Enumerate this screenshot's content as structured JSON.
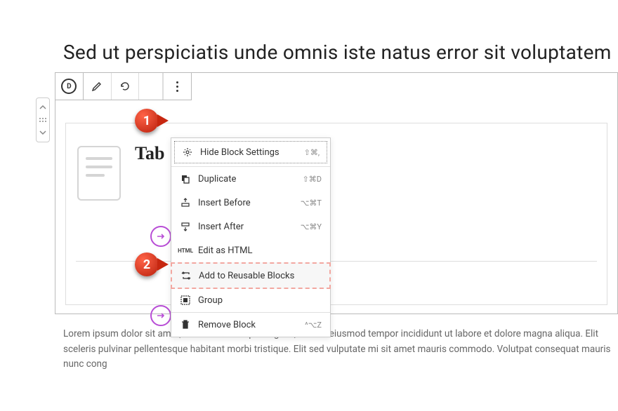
{
  "page": {
    "title": "Sed ut perspiciatis unde omnis iste natus error sit voluptatem"
  },
  "toolbar": {
    "divi_logo": "D"
  },
  "content": {
    "tab_label": "Tab",
    "body_text": "Lorem ipsum dolor sit amet, consectetur adipiscing elit, sed do eiusmod tempor incididunt ut labore et dolore magna aliqua. Elit sceleris pulvinar pellentesque habitant morbi tristique. Elit sed vulputate mi sit amet mauris commodo. Volutpat consequat mauris nunc cong"
  },
  "menu": {
    "items": [
      {
        "label": "Hide Block Settings",
        "shortcut": "⇧⌘,"
      },
      {
        "label": "Duplicate",
        "shortcut": "⇧⌘D"
      },
      {
        "label": "Insert Before",
        "shortcut": "⌥⌘T"
      },
      {
        "label": "Insert After",
        "shortcut": "⌥⌘Y"
      },
      {
        "label": "Edit as HTML",
        "shortcut": ""
      },
      {
        "label": "Add to Reusable Blocks",
        "shortcut": ""
      },
      {
        "label": "Group",
        "shortcut": ""
      },
      {
        "label": "Remove Block",
        "shortcut": "^⌥Z"
      }
    ]
  },
  "badges": {
    "one": "1",
    "two": "2"
  }
}
